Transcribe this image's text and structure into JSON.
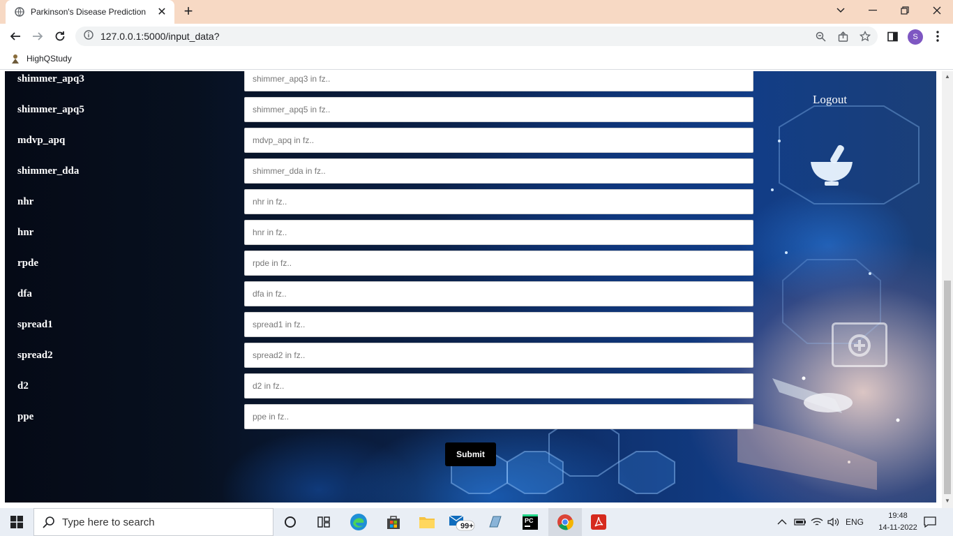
{
  "browser": {
    "tab_title": "Parkinson's Disease Prediction",
    "url": "127.0.0.1:5000/input_data?",
    "bookmark": "HighQStudy",
    "profile_initial": "S"
  },
  "page": {
    "logout_label": "Logout",
    "fields": [
      {
        "label": "shimmer_apq3",
        "placeholder": "shimmer_apq3 in fz.."
      },
      {
        "label": "shimmer_apq5",
        "placeholder": "shimmer_apq5 in fz.."
      },
      {
        "label": "mdvp_apq",
        "placeholder": "mdvp_apq in fz.."
      },
      {
        "label": "shimmer_dda",
        "placeholder": "shimmer_dda in fz.."
      },
      {
        "label": "nhr",
        "placeholder": "nhr in fz.."
      },
      {
        "label": "hnr",
        "placeholder": "hnr in fz.."
      },
      {
        "label": "rpde",
        "placeholder": "rpde in fz.."
      },
      {
        "label": "dfa",
        "placeholder": "dfa in fz.."
      },
      {
        "label": "spread1",
        "placeholder": "spread1 in fz.."
      },
      {
        "label": "spread2",
        "placeholder": "spread2 in fz.."
      },
      {
        "label": "d2",
        "placeholder": "d2 in fz.."
      },
      {
        "label": "ppe",
        "placeholder": "ppe in fz.."
      }
    ],
    "submit_label": "Submit"
  },
  "taskbar": {
    "search_placeholder": "Type here to search",
    "mail_badge": "99+",
    "language": "ENG",
    "time": "19:48",
    "date": "14-11-2022"
  },
  "colors": {
    "tabbar_bg": "#f7d9c4",
    "submit_bg": "#000000",
    "profile_bg": "#7e57c2"
  }
}
